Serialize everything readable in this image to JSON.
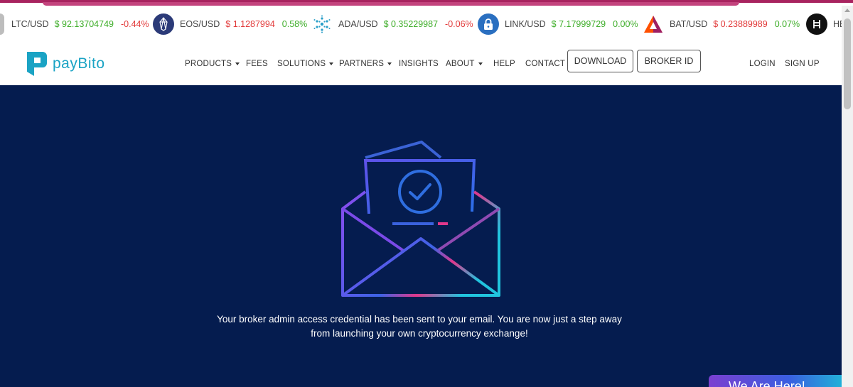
{
  "ticker": [
    {
      "pair": "LTC/USD",
      "price": "$ 92.13704749",
      "change": "-0.44%",
      "price_dir": "up",
      "change_dir": "down",
      "icon": "ltc-icon"
    },
    {
      "pair": "EOS/USD",
      "price": "$ 1.1287994",
      "change": "0.58%",
      "price_dir": "down",
      "change_dir": "up",
      "icon": "eos-icon"
    },
    {
      "pair": "ADA/USD",
      "price": "$ 0.35229987",
      "change": "-0.06%",
      "price_dir": "up",
      "change_dir": "down",
      "icon": "ada-icon"
    },
    {
      "pair": "LINK/USD",
      "price": "$ 7.17999729",
      "change": "0.00%",
      "price_dir": "up",
      "change_dir": "up",
      "icon": "link-icon"
    },
    {
      "pair": "BAT/USD",
      "price": "$ 0.23889989",
      "change": "0.07%",
      "price_dir": "down",
      "change_dir": "up",
      "icon": "bat-icon"
    },
    {
      "pair": "HE",
      "price": "",
      "change": "",
      "price_dir": "up",
      "change_dir": "up",
      "icon": "hbar-icon"
    }
  ],
  "brand": {
    "name": "payBito",
    "primary": "#1aa3c4",
    "logo_icon": "paybito-logo-icon"
  },
  "nav": {
    "items": [
      {
        "label": "PRODUCTS",
        "dropdown": true
      },
      {
        "label": "FEES",
        "dropdown": false
      },
      {
        "label": "SOLUTIONS",
        "dropdown": true
      },
      {
        "label": "PARTNERS",
        "dropdown": true
      },
      {
        "label": "INSIGHTS",
        "dropdown": false
      },
      {
        "label": "ABOUT",
        "dropdown": true
      },
      {
        "label": "HELP",
        "dropdown": false
      },
      {
        "label": "CONTACT",
        "dropdown": false
      }
    ],
    "download_label": "DOWNLOAD",
    "broker_label": "BROKER ID",
    "login_label": "LOGIN",
    "signup_label": "SIGN UP"
  },
  "hero": {
    "background": "#051c4f",
    "icon": "email-sent-check-icon",
    "message_line1": "Your broker admin access credential has been sent to your email. You are now just a step away",
    "message_line2": "from launching your own cryptocurrency exchange!"
  },
  "chat_widget": {
    "label": "We Are Here!"
  },
  "colors": {
    "positive": "#3fae2a",
    "negative": "#e23b3b",
    "accent_pink": "#e0388c",
    "accent_cyan": "#21c4de",
    "accent_purple": "#8b4cf0"
  }
}
